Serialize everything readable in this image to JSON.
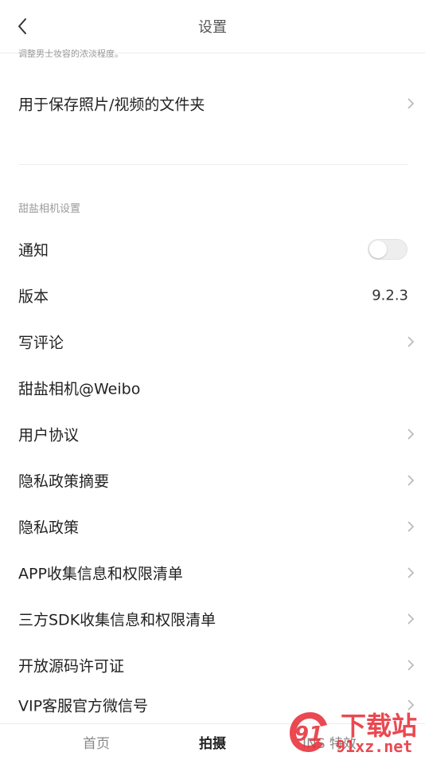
{
  "header": {
    "title": "设置"
  },
  "partial_text": "调整男士妆容的浓淡程度。",
  "folder_row": {
    "label": "用于保存照片/视频的文件夹"
  },
  "section_title": "甜盐相机设置",
  "notification": {
    "label": "通知",
    "enabled": false
  },
  "version": {
    "label": "版本",
    "value": "9.2.3"
  },
  "rows": [
    {
      "label": "写评论"
    },
    {
      "label": "甜盐相机@Weibo"
    },
    {
      "label": "用户协议"
    },
    {
      "label": "隐私政策摘要"
    },
    {
      "label": "隐私政策"
    },
    {
      "label": "APP收集信息和权限清单"
    },
    {
      "label": "三方SDK收集信息和权限清单"
    },
    {
      "label": "开放源码许可证"
    },
    {
      "label": "VIP客服官方微信号"
    }
  ],
  "tabs": [
    {
      "label": "首页"
    },
    {
      "label": "拍摄",
      "active": true
    },
    {
      "label": "INS 特效"
    }
  ],
  "watermark": {
    "brand": "下载站",
    "url": "91xz.net",
    "logo_text": "91"
  },
  "colors": {
    "accent_red": "#e8303a",
    "text": "#222222",
    "muted": "#9a9a9a"
  }
}
